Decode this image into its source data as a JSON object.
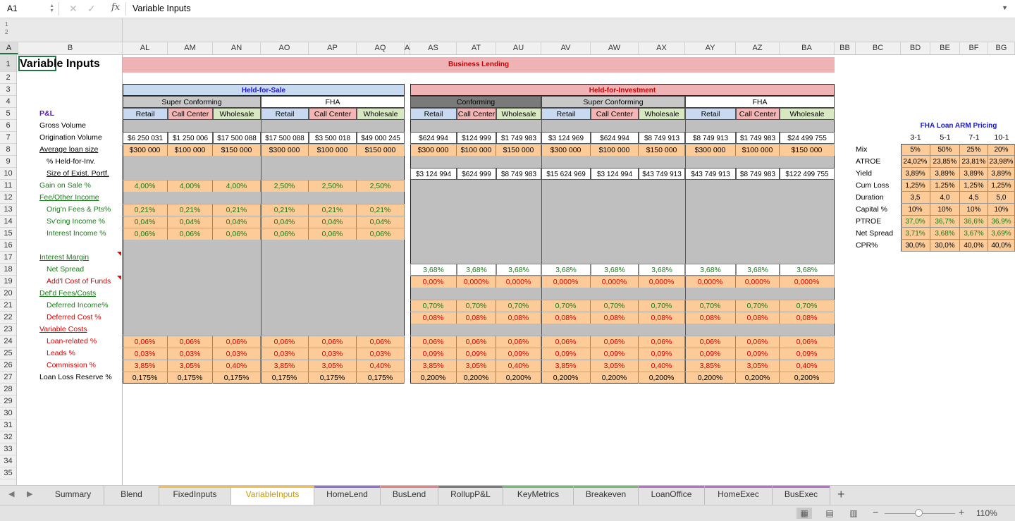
{
  "name_box": "A1",
  "formula_content": "Variable Inputs",
  "outline_levels": [
    "1",
    "2"
  ],
  "columns": [
    "A",
    "B",
    "AL",
    "AM",
    "AN",
    "AO",
    "AP",
    "AQ",
    "A",
    "AS",
    "AT",
    "AU",
    "AV",
    "AW",
    "AX",
    "AY",
    "AZ",
    "BA",
    "BB",
    "BC",
    "BD",
    "BE",
    "BF",
    "BG"
  ],
  "rows": [
    "1",
    "2",
    "3",
    "4",
    "5",
    "6",
    "7",
    "8",
    "9",
    "10",
    "11",
    "12",
    "13",
    "14",
    "15",
    "16",
    "17",
    "18",
    "19",
    "20",
    "21",
    "22",
    "23",
    "24",
    "25",
    "26",
    "27",
    "28",
    "29",
    "30",
    "31",
    "32",
    "33",
    "34",
    "35"
  ],
  "title": "Variable Inputs",
  "business_lending": "Business Lending",
  "held_for_sale": "Held-for-Sale",
  "held_for_investment": "Held-for-Investment",
  "hfs_groups": [
    "Super Conforming",
    "FHA"
  ],
  "hfi_groups": [
    "Conforming",
    "Super Conforming",
    "FHA"
  ],
  "channels": [
    "Retail",
    "Call Center",
    "Wholesale"
  ],
  "labels": {
    "pl": "P&L",
    "gross_volume": "Gross Volume",
    "orig_volume": "Origination Volume",
    "avg_loan": "Average loan size",
    "held_inv": "% Held-for-Inv.",
    "size_exist": "Size of Exist. Portf.",
    "gain_sale": "Gain on Sale %",
    "fee_other": "Fee/Other Income",
    "orig_fees": "Orig'n Fees & Pts%",
    "svc_income": "Sv'cing Income %",
    "int_income": "Interest Income %",
    "int_margin": "Interest Margin",
    "net_spread": "Net Spread",
    "addl_cost": "Add'l Cost of Funds",
    "defd_fees": "Def'd Fees/Costs",
    "deferred_income": "Deferred Income%",
    "deferred_cost": "Deferred Cost %",
    "variable_costs": "Variable Costs",
    "loan_related": "Loan-related %",
    "leads": "Leads %",
    "commission": "Commission %",
    "loss_reserve": "Loan Loss Reserve %"
  },
  "hfs_values": {
    "orig_volume": [
      "$6 250 031",
      "$1 250 006",
      "$17 500 088",
      "$17 500 088",
      "$3 500 018",
      "$49 000 245"
    ],
    "avg_loan": [
      "$300 000",
      "$100 000",
      "$150 000",
      "$300 000",
      "$100 000",
      "$150 000"
    ],
    "gain_sale": [
      "4,00%",
      "4,00%",
      "4,00%",
      "2,50%",
      "2,50%",
      "2,50%"
    ],
    "orig_fees": [
      "0,21%",
      "0,21%",
      "0,21%",
      "0,21%",
      "0,21%",
      "0,21%"
    ],
    "svc_income": [
      "0,04%",
      "0,04%",
      "0,04%",
      "0,04%",
      "0,04%",
      "0,04%"
    ],
    "int_income": [
      "0,06%",
      "0,06%",
      "0,06%",
      "0,06%",
      "0,06%",
      "0,06%"
    ],
    "loan_related": [
      "0,06%",
      "0,06%",
      "0,06%",
      "0,06%",
      "0,06%",
      "0,06%"
    ],
    "leads": [
      "0,03%",
      "0,03%",
      "0,03%",
      "0,03%",
      "0,03%",
      "0,03%"
    ],
    "commission": [
      "3,85%",
      "3,05%",
      "0,40%",
      "3,85%",
      "3,05%",
      "0,40%"
    ],
    "loss_reserve": [
      "0,175%",
      "0,175%",
      "0,175%",
      "0,175%",
      "0,175%",
      "0,175%"
    ]
  },
  "hfi_values": {
    "orig_volume": [
      "$624 994",
      "$124 999",
      "$1 749 983",
      "$3 124 969",
      "$624 994",
      "$8 749 913",
      "$8 749 913",
      "$1 749 983",
      "$24 499 755"
    ],
    "avg_loan": [
      "$300 000",
      "$100 000",
      "$150 000",
      "$300 000",
      "$100 000",
      "$150 000",
      "$300 000",
      "$100 000",
      "$150 000"
    ],
    "size_exist": [
      "$3 124 994",
      "$624 999",
      "$8 749 983",
      "$15 624 969",
      "$3 124 994",
      "$43 749 913",
      "$43 749 913",
      "$8 749 983",
      "$122 499 755"
    ],
    "net_spread": [
      "3,68%",
      "3,68%",
      "3,68%",
      "3,68%",
      "3,68%",
      "3,68%",
      "3,68%",
      "3,68%",
      "3,68%"
    ],
    "addl_cost": [
      "0,00%",
      "0,000%",
      "0,000%",
      "0,000%",
      "0,000%",
      "0,000%",
      "0,000%",
      "0,000%",
      "0,000%"
    ],
    "deferred_income": [
      "0,70%",
      "0,70%",
      "0,70%",
      "0,70%",
      "0,70%",
      "0,70%",
      "0,70%",
      "0,70%",
      "0,70%"
    ],
    "deferred_cost": [
      "0,08%",
      "0,08%",
      "0,08%",
      "0,08%",
      "0,08%",
      "0,08%",
      "0,08%",
      "0,08%",
      "0,08%"
    ],
    "loan_related": [
      "0,06%",
      "0,06%",
      "0,06%",
      "0,06%",
      "0,06%",
      "0,06%",
      "0,06%",
      "0,06%",
      "0,06%"
    ],
    "leads": [
      "0,09%",
      "0,09%",
      "0,09%",
      "0,09%",
      "0,09%",
      "0,09%",
      "0,09%",
      "0,09%",
      "0,09%"
    ],
    "commission": [
      "3,85%",
      "3,05%",
      "0,40%",
      "3,85%",
      "3,05%",
      "0,40%",
      "3,85%",
      "3,05%",
      "0,40%"
    ],
    "loss_reserve": [
      "0,200%",
      "0,200%",
      "0,200%",
      "0,200%",
      "0,200%",
      "0,200%",
      "0,200%",
      "0,200%",
      "0,200%"
    ]
  },
  "arm": {
    "title": "FHA Loan ARM Pricing",
    "headers": [
      "3-1",
      "5-1",
      "7-1",
      "10-1"
    ],
    "rows": [
      {
        "label": "Mix",
        "values": [
          "5%",
          "50%",
          "25%",
          "20%"
        ]
      },
      {
        "label": "ATROE",
        "values": [
          "24,02%",
          "23,85%",
          "23,81%",
          "23,98%"
        ]
      },
      {
        "label": "Yield",
        "values": [
          "3,89%",
          "3,89%",
          "3,89%",
          "3,89%"
        ]
      },
      {
        "label": "Cum Loss",
        "values": [
          "1,25%",
          "1,25%",
          "1,25%",
          "1,25%"
        ]
      },
      {
        "label": "Duration",
        "values": [
          "3,5",
          "4,0",
          "4,5",
          "5,0"
        ]
      },
      {
        "label": "Capital %",
        "values": [
          "10%",
          "10%",
          "10%",
          "10%"
        ]
      },
      {
        "label": "PTROE",
        "values": [
          "37,0%",
          "36,7%",
          "36,6%",
          "36,9%"
        ]
      },
      {
        "label": "Net Spread",
        "values": [
          "3,71%",
          "3,68%",
          "3,67%",
          "3,69%"
        ]
      },
      {
        "label": "CPR%",
        "values": [
          "30,0%",
          "30,0%",
          "40,0%",
          "40,0%"
        ]
      }
    ]
  },
  "tabs": [
    {
      "label": "Summary",
      "color": ""
    },
    {
      "label": "Blend",
      "color": ""
    },
    {
      "label": "FixedInputs",
      "color": "#f4c04a"
    },
    {
      "label": "VariableInputs",
      "color": "#f4c04a",
      "active": true
    },
    {
      "label": "HomeLend",
      "color": "#8e72d8"
    },
    {
      "label": "BusLend",
      "color": "#e98080"
    },
    {
      "label": "RollupP&L",
      "color": "#7a7a7a"
    },
    {
      "label": "KeyMetrics",
      "color": "#6fbf6f"
    },
    {
      "label": "Breakeven",
      "color": "#6fbf6f"
    },
    {
      "label": "LoanOffice",
      "color": "#b870d0"
    },
    {
      "label": "HomeExec",
      "color": "#b870d0"
    },
    {
      "label": "BusExec",
      "color": "#b870d0"
    }
  ],
  "zoom": "110%",
  "colors": {
    "orange": "#fccb98",
    "gray": "#bfbfbf",
    "pink_header": "#efb3b5",
    "blue_header": "#c9d9ef",
    "green_label": "#177a17",
    "red_label": "#d80000",
    "purple_label": "#5a10cc",
    "retail_bg": "#c9d9ef",
    "call_bg": "#f4b5b5",
    "wholesale_bg": "#d8e8c3"
  }
}
